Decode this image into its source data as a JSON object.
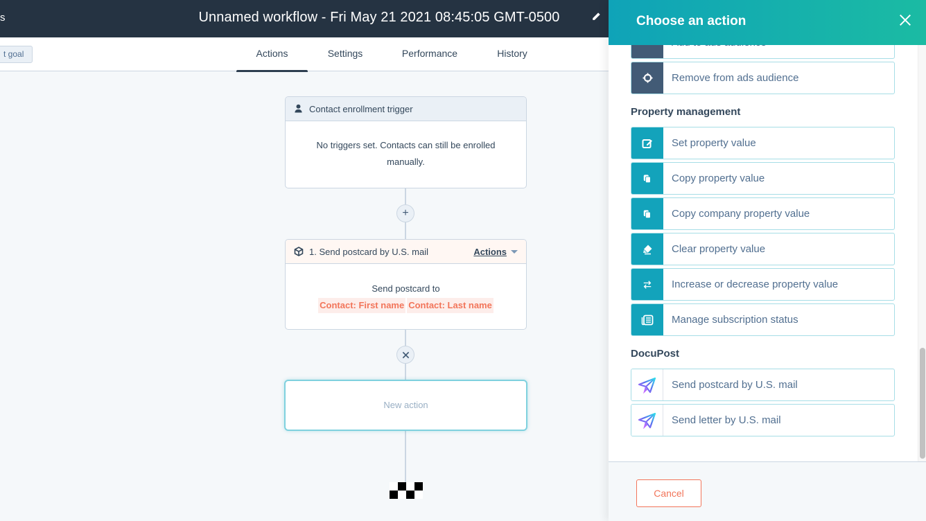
{
  "topbar": {
    "left_fragment": "s",
    "workflow_title": "Unnamed workflow - Fri May 21 2021 08:45:05 GMT-0500",
    "edit_icon": "pencil-icon"
  },
  "tabbar": {
    "goal_button": "t goal",
    "tabs": [
      {
        "label": "Actions",
        "active": true
      },
      {
        "label": "Settings",
        "active": false
      },
      {
        "label": "Performance",
        "active": false
      },
      {
        "label": "History",
        "active": false
      }
    ]
  },
  "canvas": {
    "trigger": {
      "icon": "contact-icon",
      "title": "Contact enrollment trigger",
      "body": "No triggers set. Contacts can still be enrolled manually."
    },
    "add_button_icon": "plus-icon",
    "action_card": {
      "icon": "cube-icon",
      "title": "1. Send postcard by U.S. mail",
      "actions_label": "Actions",
      "body_text": "Send postcard to",
      "tokens": [
        "Contact: First name",
        "Contact: Last name"
      ]
    },
    "remove_button_icon": "close-icon",
    "new_action_label": "New action",
    "end_icon": "finish-flag-icon"
  },
  "panel": {
    "title": "Choose an action",
    "close_icon": "close-icon",
    "partial_item": {
      "label": "Add to ads audience",
      "icon": "target-icon"
    },
    "groups": [
      {
        "name": "",
        "items": [
          {
            "label": "Remove from ads audience",
            "icon": "target-icon",
            "style": "dark"
          }
        ]
      },
      {
        "name": "Property management",
        "items": [
          {
            "label": "Set property value",
            "icon": "edit-icon",
            "style": "teal"
          },
          {
            "label": "Copy property value",
            "icon": "copy-icon",
            "style": "teal"
          },
          {
            "label": "Copy company property value",
            "icon": "copy-icon",
            "style": "teal"
          },
          {
            "label": "Clear property value",
            "icon": "eraser-icon",
            "style": "teal"
          },
          {
            "label": "Increase or decrease property value",
            "icon": "swap-arrows-icon",
            "style": "teal"
          },
          {
            "label": "Manage subscription status",
            "icon": "newspaper-icon",
            "style": "teal"
          }
        ]
      },
      {
        "name": "DocuPost",
        "items": [
          {
            "label": "Send postcard by U.S. mail",
            "icon": "paper-plane-icon",
            "style": "light"
          },
          {
            "label": "Send letter by U.S. mail",
            "icon": "paper-plane-icon",
            "style": "light"
          }
        ]
      }
    ],
    "cancel_label": "Cancel"
  },
  "colors": {
    "topbar": "#253342",
    "panel_header_start": "#0fa3b8",
    "panel_header_end": "#1bbba3",
    "teal_icon": "#13a3bb",
    "dark_icon": "#425b76",
    "accent_orange": "#f2755a"
  }
}
